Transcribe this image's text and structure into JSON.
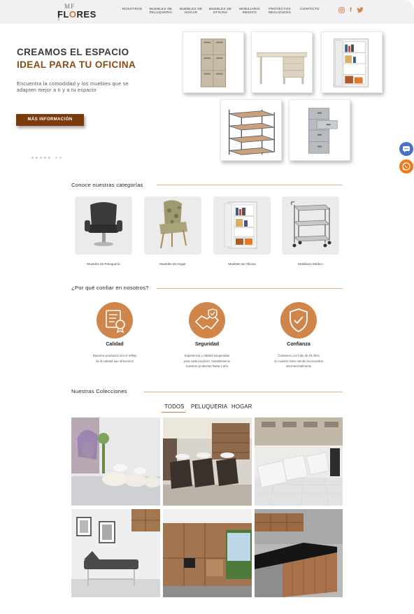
{
  "brand": {
    "logo_top": "MF",
    "logo_bottom_a": "FL",
    "logo_bottom_o": "O",
    "logo_bottom_b": "RES",
    "logo_side": "MUEBLES"
  },
  "nav": {
    "items": [
      {
        "line1": "NOSOTROS",
        "line2": ""
      },
      {
        "line1": "MUEBLES DE",
        "line2": "PELUQUERIA"
      },
      {
        "line1": "MUEBLES DE",
        "line2": "HOGAR"
      },
      {
        "line1": "MUEBLES DE",
        "line2": "OFICINA"
      },
      {
        "line1": "MOBILIARIO",
        "line2": "MEDICO"
      },
      {
        "line1": "PROYECTOS",
        "line2": "REALIZADOS"
      },
      {
        "line1": "CONTACTO",
        "line2": ""
      }
    ],
    "social_icons": [
      "instagram-icon",
      "facebook-icon",
      "twitter-icon"
    ]
  },
  "hero": {
    "title_line1": "CREAMOS EL ESPACIO",
    "title_line2": "IDEAL PARA TU OFICINA",
    "subtitle": "Encuentra la comodidad y los muebles que se adapten mejor a ti y a tu espacio",
    "cta": "MÁS INFORMACIÓN",
    "products": [
      "locker-cabinet",
      "office-desk",
      "storage-cabinet",
      "metal-shelving",
      "filing-cabinet"
    ]
  },
  "floating": {
    "chat_icon": "chat-icon",
    "whatsapp_icon": "whatsapp-icon"
  },
  "categories": {
    "title": "Conoce nuestras categorías",
    "items": [
      {
        "label": "Muebles de Peluquería",
        "icon": "salon-chair"
      },
      {
        "label": "Muebles de Hogar",
        "icon": "armchair"
      },
      {
        "label": "Muebles de Oficina",
        "icon": "office-cabinet"
      },
      {
        "label": "Mobiliario Médico",
        "icon": "medical-cart"
      }
    ]
  },
  "trust": {
    "title": "¿Por qué confiar en nosotros?",
    "items": [
      {
        "title": "Calidad",
        "desc_line1": "Nuestros productos son el reflejo",
        "desc_line2": "de la calidad que ofrecemos",
        "desc_line3": "",
        "icon": "certificate-icon"
      },
      {
        "title": "Seguridad",
        "desc_line1": "Experiencia y calidad aseguradas",
        "desc_line2": "para cada proyecto. Garantizamos",
        "desc_line3": "nuestros productos hasta 1 año",
        "icon": "handshake-icon"
      },
      {
        "title": "Confianza",
        "desc_line1": "Contamos con más de 18 años",
        "desc_line2": "en nuestro rubro siendo reconocidos",
        "desc_line3": "internacionalmente",
        "icon": "shield-check-icon"
      }
    ]
  },
  "collections": {
    "title": "Nuestras Colecciones",
    "tabs": [
      "TODOS",
      "PELUQUERIA",
      "HOGAR"
    ],
    "active_tab": "TODOS",
    "photos": [
      "salon-wash-station",
      "salon-wash-chairs",
      "salon-wash-room",
      "medical-exam-room",
      "wood-reception-lobby",
      "kitchen-bar-counter"
    ]
  },
  "colors": {
    "accent": "#d0864a",
    "dark_brown": "#7a3a0c",
    "title_brown": "#8a4a12",
    "header_bg": "#f1f1f3"
  }
}
